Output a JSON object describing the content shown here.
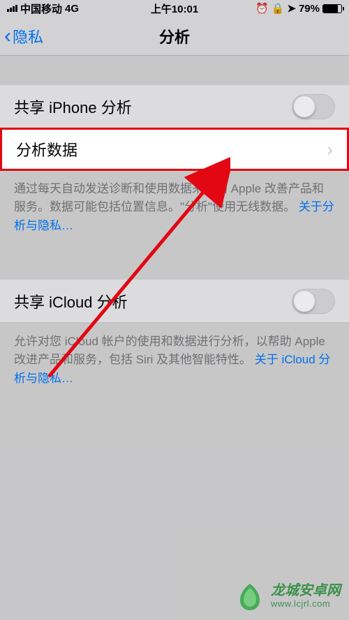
{
  "status": {
    "carrier": "中国移动",
    "network": "4G",
    "time": "上午10:01",
    "battery_pct": "79%",
    "battery_fill_pct": 79
  },
  "nav": {
    "back_label": "隐私",
    "title": "分析"
  },
  "rows": {
    "share_iphone": {
      "label": "共享 iPhone 分析"
    },
    "analytics_data": {
      "label": "分析数据"
    },
    "share_icloud": {
      "label": "共享 iCloud 分析"
    }
  },
  "footers": {
    "iphone": {
      "text": "通过每天自动发送诊断和使用数据来帮助 Apple 改善产品和服务。数据可能包括位置信息。\"分析\"使用无线数据。",
      "link": "关于分析与隐私…"
    },
    "icloud": {
      "text": "允许对您 iCloud 帐户的使用和数据进行分析，以帮助 Apple 改进产品和服务，包括 Siri 及其他智能特性。",
      "link": "关于 iCloud 分析与隐私…"
    }
  },
  "watermark": {
    "line1": "龙城安卓网",
    "line2": "www.lcjrl.com"
  }
}
